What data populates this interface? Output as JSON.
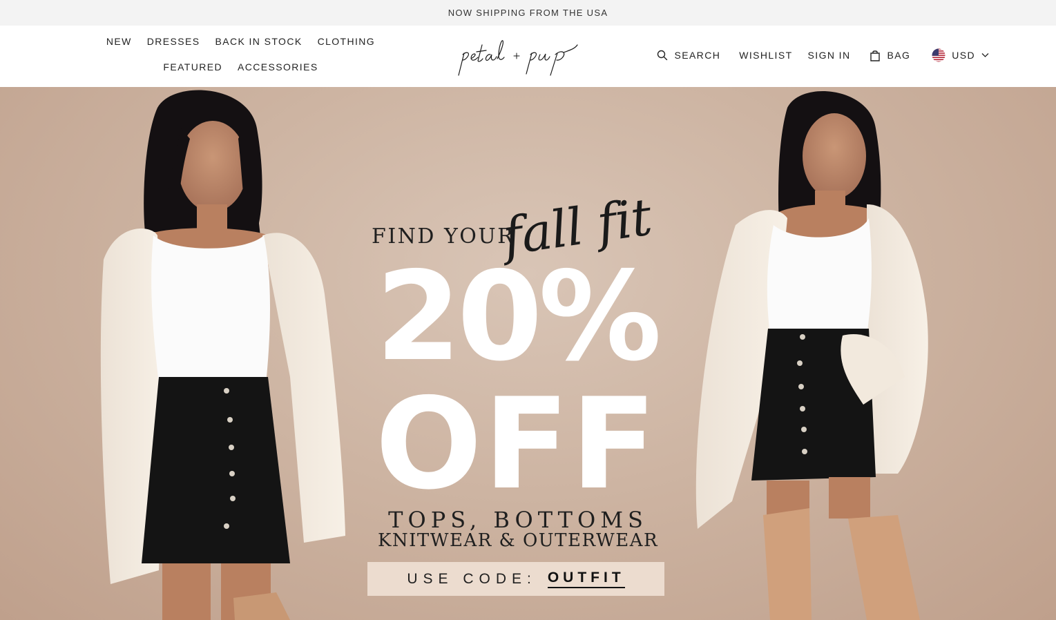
{
  "announcement": {
    "text": "NOW SHIPPING FROM THE USA"
  },
  "nav": {
    "items": [
      {
        "label": "NEW"
      },
      {
        "label": "DRESSES"
      },
      {
        "label": "BACK IN STOCK"
      },
      {
        "label": "CLOTHING"
      },
      {
        "label": "FEATURED"
      },
      {
        "label": "ACCESSORIES"
      }
    ]
  },
  "logo": {
    "text": "petal + pup"
  },
  "header_right": {
    "search_label": "SEARCH",
    "wishlist_label": "WISHLIST",
    "signin_label": "SIGN IN",
    "bag_label": "BAG",
    "currency_label": "USD"
  },
  "hero": {
    "line1": "FIND YOUR",
    "script": "fall fit",
    "percent": "20%",
    "off": "OFF",
    "categories_line1": "TOPS, BOTTOMS",
    "categories_line2": "KNITWEAR & OUTERWEAR",
    "code_label": "USE CODE:",
    "code_value": "OUTFIT"
  },
  "colors": {
    "announcement_bg": "#f3f3f3",
    "hero_bg": "#cdb4a2",
    "code_box_bg": "#ecdccf",
    "text_dark": "#1f1f1f"
  },
  "icons": {
    "search": "search-icon",
    "bag": "bag-icon",
    "flag": "us-flag-icon",
    "chevron": "chevron-down-icon"
  }
}
